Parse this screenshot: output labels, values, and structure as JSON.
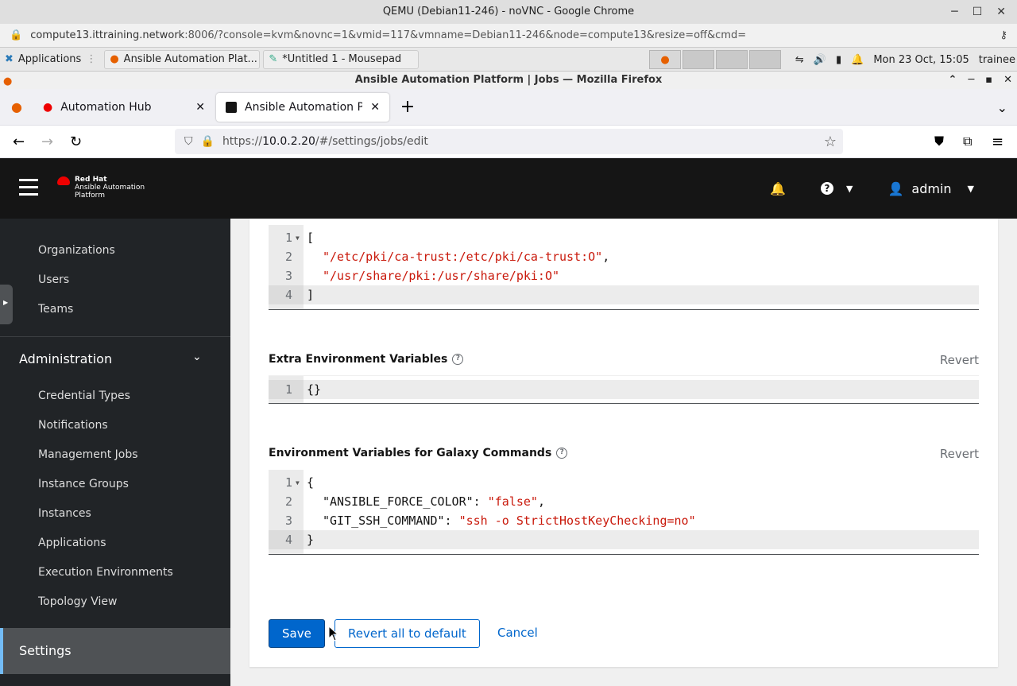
{
  "chrome": {
    "title": "QEMU (Debian11-246) - noVNC - Google Chrome",
    "url_host": "compute13.ittraining.network",
    "url_rest": ":8006/?console=kvm&novnc=1&vmid=117&vmname=Debian11-246&node=compute13&resize=off&cmd="
  },
  "taskbar": {
    "applications_label": "Applications",
    "task1": "Ansible Automation Plat...",
    "task2": "*Untitled 1 - Mousepad",
    "clock": "Mon 23 Oct, 15:05",
    "user": "trainee"
  },
  "firefox": {
    "window_title": "Ansible Automation Platform | Jobs — Mozilla Firefox",
    "tabs": [
      {
        "label": "Automation Hub"
      },
      {
        "label": "Ansible Automation Platfo"
      }
    ],
    "url_prefix": "https://",
    "url_host": "10.0.2.20",
    "url_path": "/#/settings/jobs/edit"
  },
  "header": {
    "brand_line1": "Red Hat",
    "brand_line2": "Ansible Automation",
    "brand_line3": "Platform",
    "user": "admin"
  },
  "sidebar": {
    "access_items": [
      "Organizations",
      "Users",
      "Teams"
    ],
    "admin_group": "Administration",
    "admin_items": [
      "Credential Types",
      "Notifications",
      "Management Jobs",
      "Instance Groups",
      "Instances",
      "Applications",
      "Execution Environments",
      "Topology View"
    ],
    "settings": "Settings"
  },
  "form": {
    "paths_editor": {
      "lines": [
        "[",
        "\"/etc/pki/ca-trust:/etc/pki/ca-trust:O\"",
        "\"/usr/share/pki:/usr/share/pki:O\"",
        "]"
      ],
      "comma": ","
    },
    "extra_env": {
      "label": "Extra Environment Variables",
      "revert": "Revert",
      "line1": "{}"
    },
    "galaxy_env": {
      "label": "Environment Variables for Galaxy Commands",
      "revert": "Revert",
      "open": "{",
      "key1": "\"ANSIBLE_FORCE_COLOR\"",
      "val1": "\"false\"",
      "key2": "\"GIT_SSH_COMMAND\"",
      "val2": "\"ssh -o StrictHostKeyChecking=no\"",
      "close": "}"
    },
    "buttons": {
      "save": "Save",
      "revert_all": "Revert all to default",
      "cancel": "Cancel"
    }
  }
}
